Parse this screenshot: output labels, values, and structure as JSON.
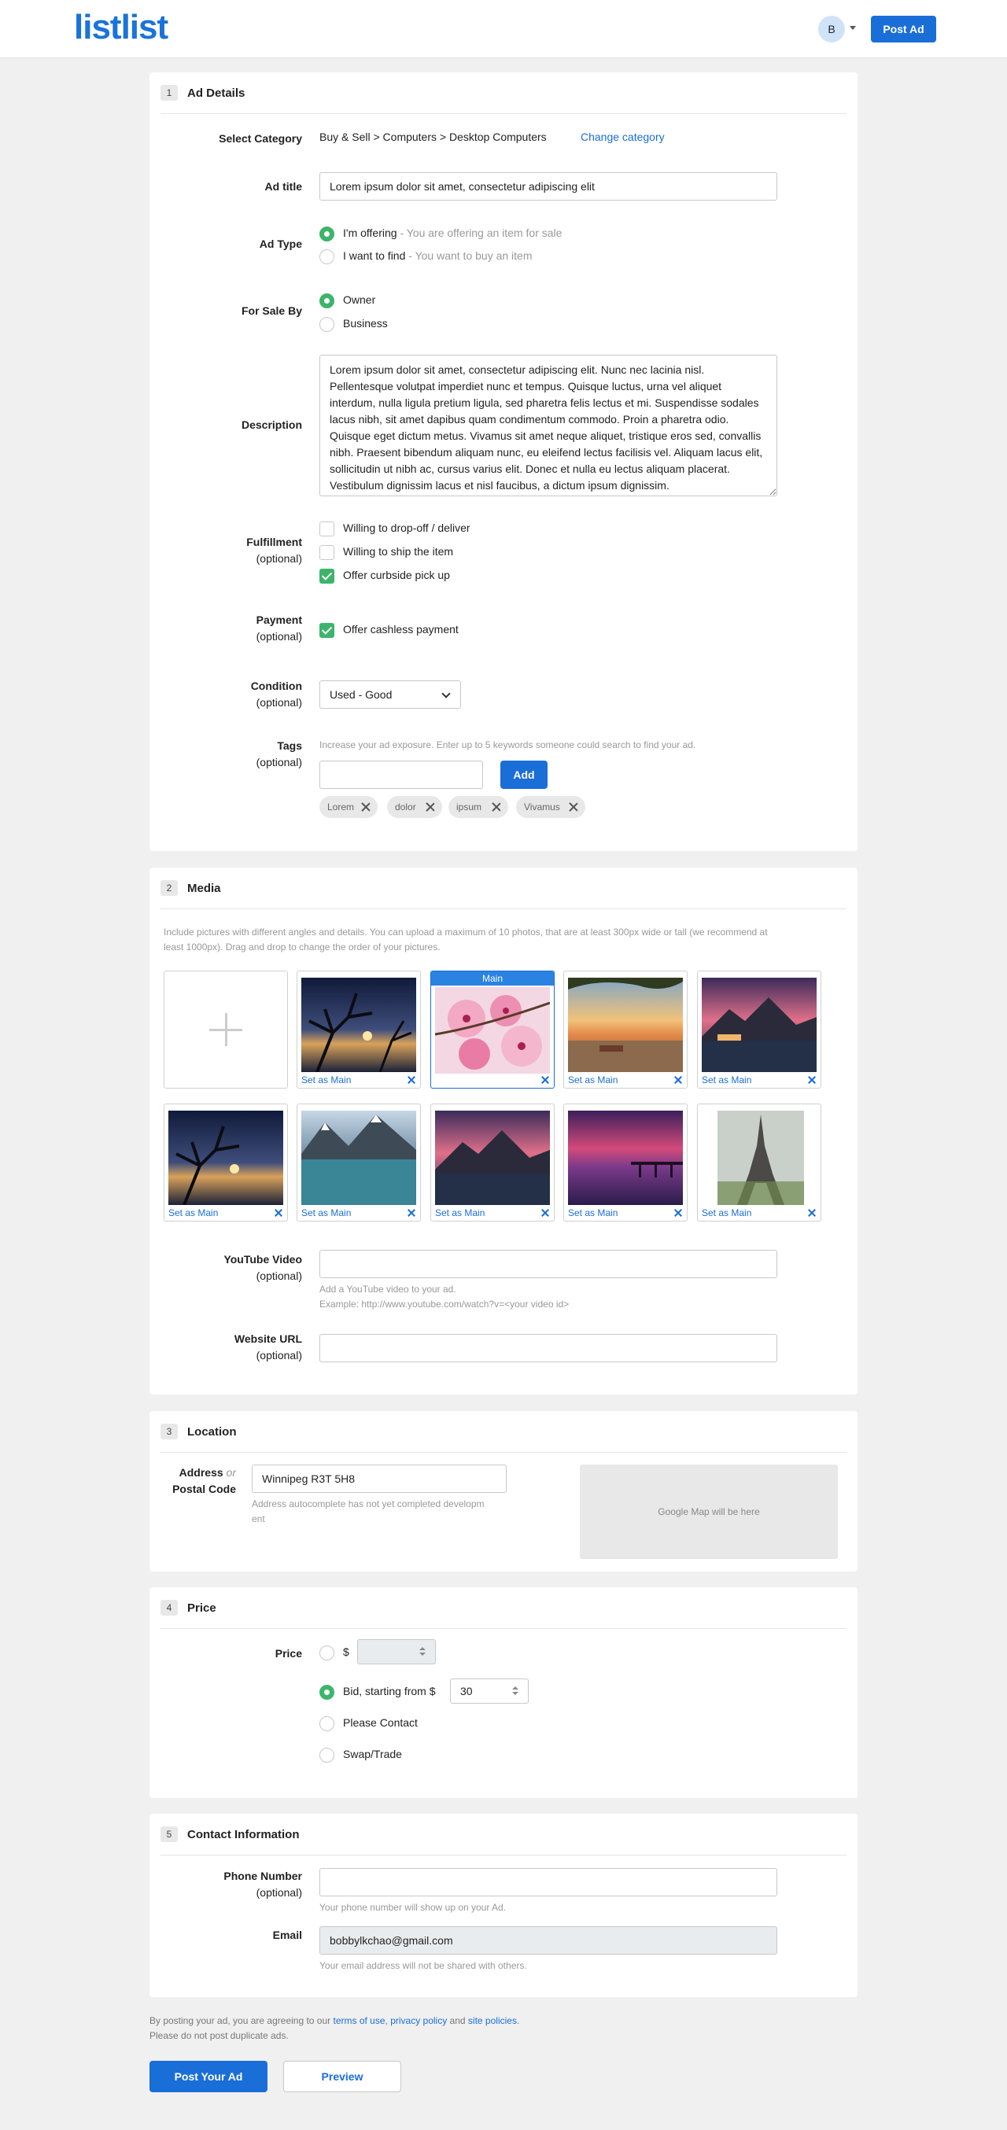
{
  "app": {
    "logo": "listlist",
    "avatar_initial": "B",
    "post_ad": "Post Ad"
  },
  "ad_details": {
    "step": "1",
    "title": "Ad Details",
    "category_label": "Select Category",
    "category_path": "Buy & Sell > Computers > Desktop Computers",
    "change_category": "Change category",
    "ad_title_label": "Ad title",
    "ad_title_value": "Lorem ipsum dolor sit amet, consectetur adipiscing elit",
    "ad_type_label": "Ad Type",
    "ad_type_options": [
      {
        "label": "I'm offering",
        "desc": " - You are offering an item for sale",
        "selected": true
      },
      {
        "label": "I want to find",
        "desc": " - You want to buy an item",
        "selected": false
      }
    ],
    "for_sale_label": "For Sale By",
    "for_sale_options": [
      {
        "label": "Owner",
        "selected": true
      },
      {
        "label": "Business",
        "selected": false
      }
    ],
    "description_label": "Description",
    "description_value": "Lorem ipsum dolor sit amet, consectetur adipiscing elit. Nunc nec lacinia nisl. Pellentesque volutpat imperdiet nunc et tempus. Quisque luctus, urna vel aliquet interdum, nulla ligula pretium ligula, sed pharetra felis lectus et mi. Suspendisse sodales lacus nibh, sit amet dapibus quam condimentum commodo. Proin a pharetra odio. Quisque eget dictum metus. Vivamus sit amet neque aliquet, tristique eros sed, convallis nibh. Praesent bibendum aliquam nunc, eu eleifend lectus facilisis vel. Aliquam lacus elit, sollicitudin ut nibh ac, cursus varius elit. Donec et nulla eu lectus aliquam placerat. Vestibulum dignissim lacus et nisl faucibus, a dictum ipsum dignissim.",
    "fulfillment_label": "Fulfillment",
    "optional": "(optional)",
    "fulfillment_options": [
      {
        "label": "Willing to drop-off / deliver",
        "checked": false
      },
      {
        "label": "Willing to ship the item",
        "checked": false
      },
      {
        "label": "Offer curbside pick up",
        "checked": true
      }
    ],
    "payment_label": "Payment",
    "payment_option": {
      "label": "Offer cashless payment",
      "checked": true
    },
    "condition_label": "Condition",
    "condition_value": "Used - Good",
    "tags_label": "Tags",
    "tags_hint": "Increase your ad exposure. Enter up to 5 keywords someone could search to find your ad.",
    "tags_add": "Add",
    "tags": [
      "Lorem",
      "dolor",
      "ipsum",
      "Vivamus"
    ]
  },
  "media": {
    "step": "2",
    "title": "Media",
    "hint_line1": "Include pictures with different angles and details. You can upload a maximum of 10 photos, that are at least 300px wide or tall (we recommend at",
    "hint_line2": "least 1000px). Drag and drop to change the order of your pictures.",
    "main_label": "Main",
    "set_main": "Set as Main",
    "youtube_label": "YouTube Video",
    "youtube_hint1": "Add a YouTube video to your ad.",
    "youtube_hint2": "Example: http://www.youtube.com/watch?v=<your video id>",
    "website_label": "Website URL",
    "photos": [
      "night-tree-lake-photo",
      "cherry-blossom-photo",
      "beach-sunset-photo",
      "mountain-lake-sunset-photo",
      "night-tree-lake-photo",
      "glacier-lake-photo",
      "mountain-lake-sunset-photo",
      "pier-sunset-photo",
      "eiffel-tower-photo"
    ]
  },
  "location": {
    "step": "3",
    "title": "Location",
    "address_label": "Address",
    "or": "or",
    "postal_label": "Postal Code",
    "address_value": "Winnipeg R3T 5H8",
    "address_hint1": "Address autocomplete has not yet completed developm",
    "address_hint2": "ent",
    "map_placeholder": "Google Map will be here"
  },
  "price": {
    "step": "4",
    "title": "Price",
    "price_label": "Price",
    "dollar": "$",
    "bid_label": "Bid, starting from $",
    "bid_value": "30",
    "contact_label": "Please Contact",
    "swap_label": "Swap/Trade"
  },
  "contact": {
    "step": "5",
    "title": "Contact Information",
    "phone_label": "Phone Number",
    "phone_hint": "Your phone number will show up on your Ad.",
    "email_label": "Email",
    "email_value": "bobbylkchao@gmail.com",
    "email_hint": "Your email address will not be shared with others."
  },
  "footer": {
    "agree_prefix": "By posting your ad, you are agreeing to our ",
    "terms": "terms of use",
    "sep": ", ",
    "privacy": "privacy policy",
    "and": " and ",
    "site_policies": "site policies",
    "period": ".",
    "duplicate": "Please do not post duplicate ads.",
    "post_button": "Post Your Ad",
    "preview_button": "Preview"
  },
  "colors": {
    "brand": "#1a73d9",
    "accent": "#1a6ed8",
    "check_green": "#3cb56b"
  }
}
